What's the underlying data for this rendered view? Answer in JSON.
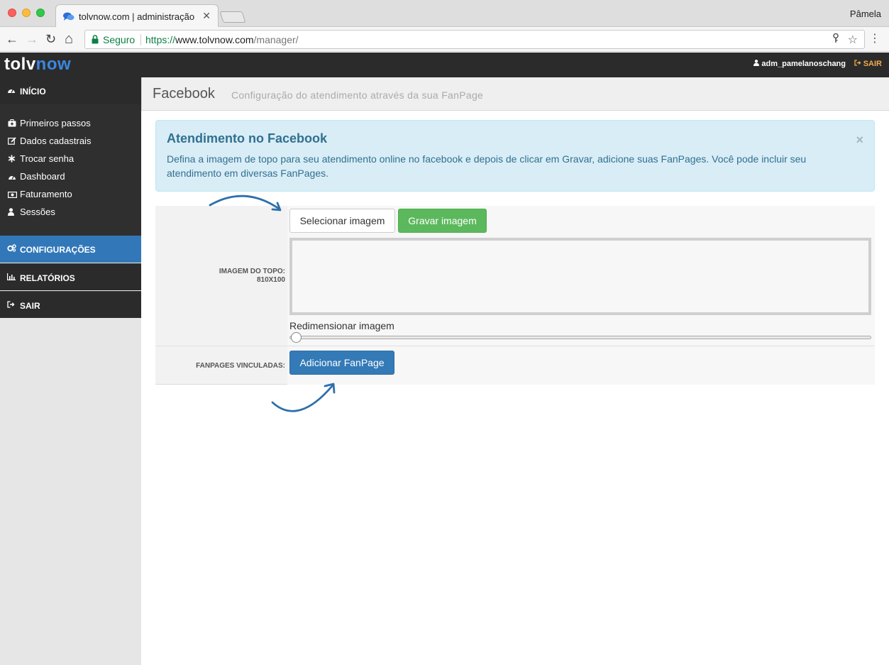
{
  "browser": {
    "tab_title": "tolvnow.com | administração",
    "tab_close": "✕",
    "profile_name": "Pâmela",
    "secure_label": "Seguro",
    "url_scheme": "https://",
    "url_host": "www.tolvnow.com",
    "url_path": "/manager/",
    "back_icon": "←",
    "forward_icon": "→",
    "reload_icon": "↻",
    "home_icon": "⌂",
    "star_icon": "☆",
    "menu_icon": "⋮"
  },
  "header": {
    "logo_tolv": "tolv",
    "logo_now": "now",
    "username": "adm_pamelanoschang",
    "logout_label": "SAIR",
    "colors": {
      "logo_accent": "#3a87e0",
      "logout": "#f0ad4e"
    }
  },
  "sidebar": {
    "inicio": {
      "label": "INÍCIO",
      "icon": "dashboard-icon"
    },
    "subitems": [
      {
        "label": "Primeiros passos",
        "icon": "medkit-icon"
      },
      {
        "label": "Dados cadastrais",
        "icon": "edit-icon"
      },
      {
        "label": "Trocar senha",
        "icon": "asterisk-icon"
      },
      {
        "label": "Dashboard",
        "icon": "dashboard-icon"
      },
      {
        "label": "Faturamento",
        "icon": "money-icon"
      },
      {
        "label": "Sessões",
        "icon": "user-icon"
      }
    ],
    "main": [
      {
        "label": "CONFIGURAÇÕES",
        "icon": "gears-icon",
        "active": true
      },
      {
        "label": "RELATÓRIOS",
        "icon": "bar-chart-icon",
        "active": false
      },
      {
        "label": "SAIR",
        "icon": "sign-out-icon",
        "active": false
      }
    ],
    "colors": {
      "active": "#3278b8",
      "dark": "#2b2b2b"
    }
  },
  "page": {
    "title": "Facebook",
    "subtitle": "Configuração do atendimento através da sua FanPage"
  },
  "alert": {
    "title": "Atendimento no Facebook",
    "text": "Defina a imagem de topo para seu atendimento online no facebook e depois de clicar em Gravar, adicione suas FanPages. Você pode incluir seu atendimento em diversas FanPages.",
    "close": "×"
  },
  "form": {
    "top_image_label_line1": "IMAGEM DO TOPO:",
    "top_image_label_line2": "810X100",
    "select_image_button": "Selecionar imagem",
    "save_image_button": "Gravar imagem",
    "resize_label": "Redimensionar imagem",
    "resize_value": 0,
    "fanpages_label": "FANPAGES VINCULADAS:",
    "add_fanpage_button": "Adicionar FanPage"
  }
}
